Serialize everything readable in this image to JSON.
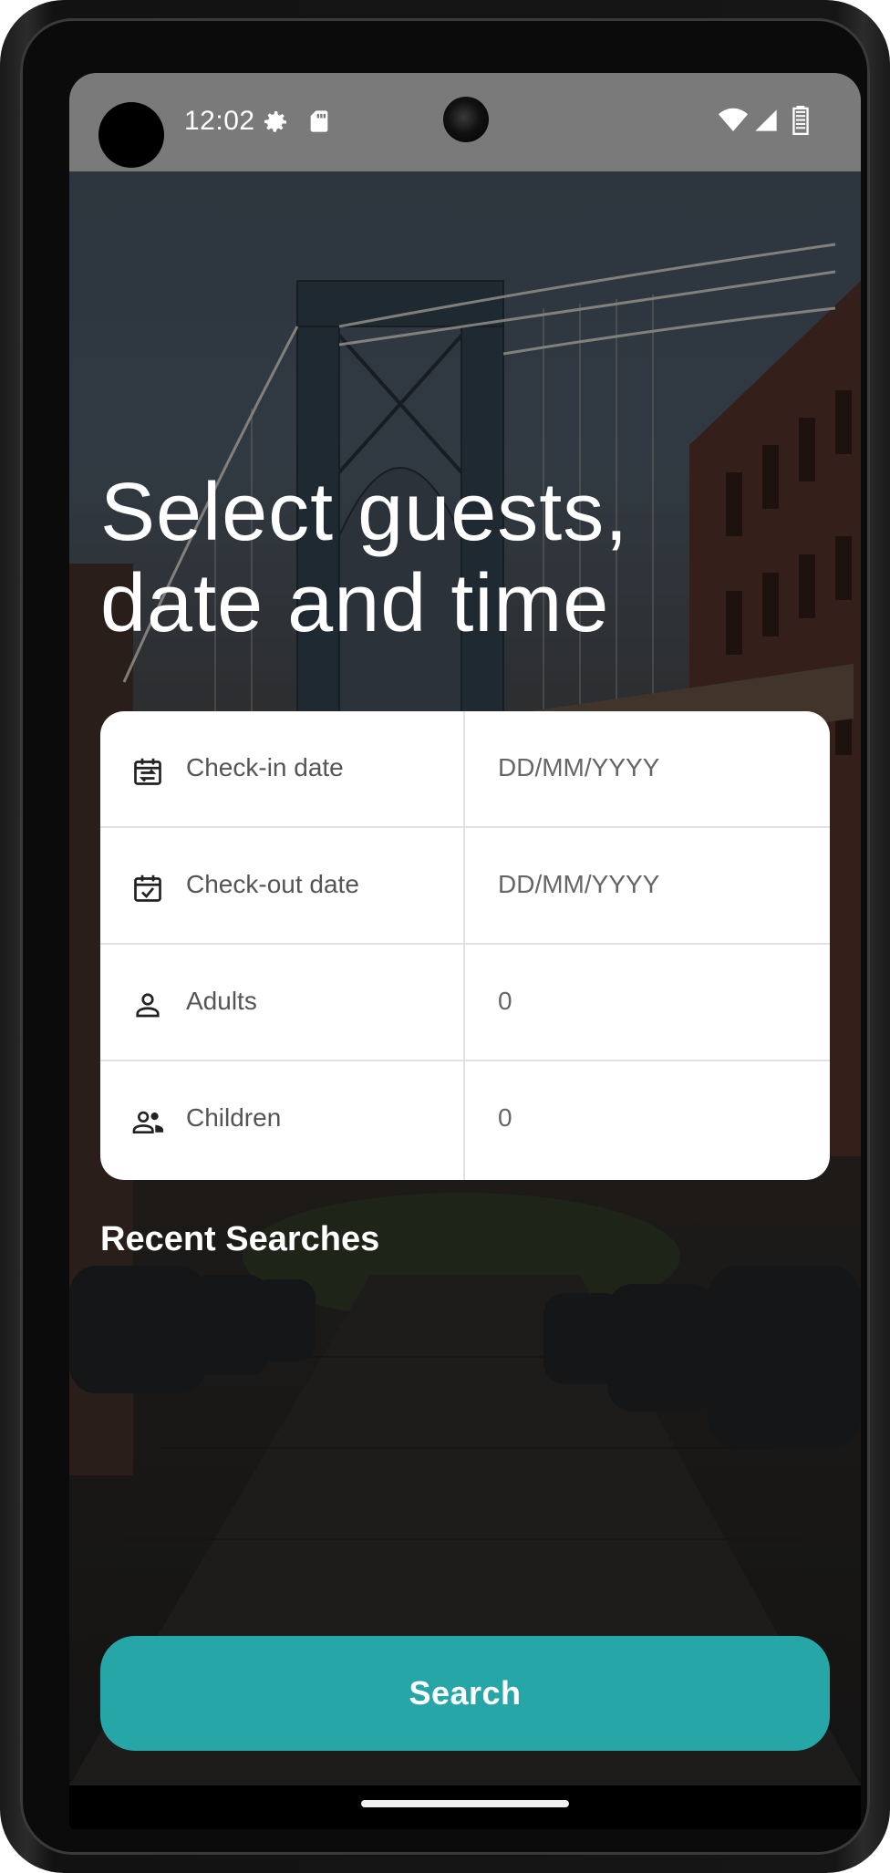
{
  "status_bar": {
    "time": "12:02",
    "icons": [
      "settings-gear-icon",
      "sd-card-icon",
      "wifi-icon",
      "cellular-signal-icon",
      "battery-icon"
    ]
  },
  "background": {
    "image": "bridge-street-photo"
  },
  "headline": "Select guests, date and time",
  "form": {
    "rows": [
      {
        "icon": "calendar-check-in-icon",
        "label": "Check-in date",
        "value": "DD/MM/YYYY"
      },
      {
        "icon": "calendar-check-out-icon",
        "label": "Check-out date",
        "value": "DD/MM/YYYY"
      },
      {
        "icon": "person-icon",
        "label": "Adults",
        "value": "0"
      },
      {
        "icon": "people-icon",
        "label": "Children",
        "value": "0"
      }
    ]
  },
  "recent_searches": {
    "title": "Recent Searches"
  },
  "search_button": {
    "label": "Search"
  },
  "colors": {
    "accent": "#26a6a6",
    "card": "#ffffff",
    "status_bar": "#7a7a7a",
    "label_text": "#555555"
  }
}
